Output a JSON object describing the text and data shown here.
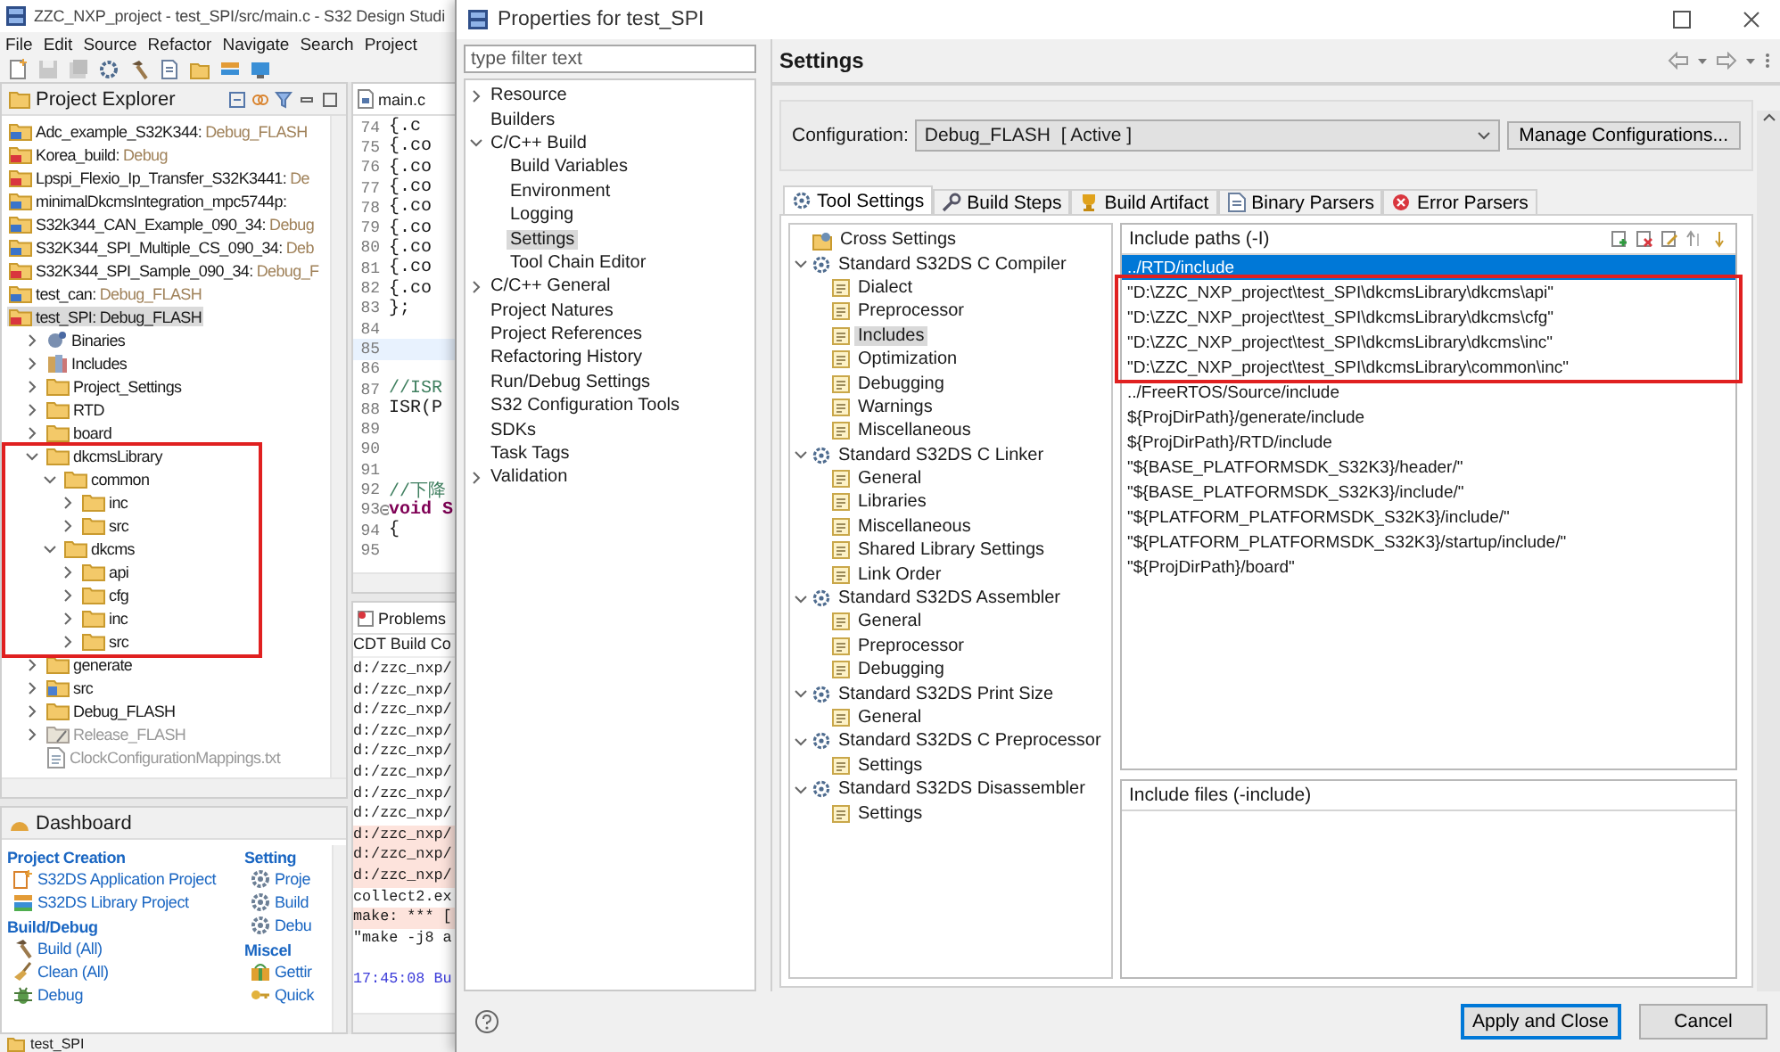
{
  "ide": {
    "title": "ZZC_NXP_project - test_SPI/src/main.c - S32 Design Studi",
    "menu": [
      "File",
      "Edit",
      "Source",
      "Refactor",
      "Navigate",
      "Search",
      "Project"
    ],
    "explorer": {
      "title": "Project Explorer",
      "items": [
        {
          "name": "Adc_example_S32K344:",
          "config": "Debug_FLASH",
          "kind": "project",
          "selected": false
        },
        {
          "name": "Korea_build:",
          "config": "Debug",
          "kind": "closed-project",
          "selected": false
        },
        {
          "name": "Lpspi_Flexio_Ip_Transfer_S32K3441:",
          "config": "De",
          "kind": "closed-project",
          "selected": false
        },
        {
          "name": "minimalDkcmsIntegration_mpc5744p:",
          "kind": "project",
          "selected": false
        },
        {
          "name": "S32k344_CAN_Example_090_34:",
          "config": "Debug",
          "kind": "project",
          "selected": false
        },
        {
          "name": "S32K344_SPI_Multiple_CS_090_34:",
          "config": "Deb",
          "kind": "project",
          "selected": false
        },
        {
          "name": "S32K344_SPI_Sample_090_34:",
          "config": "Debug_F",
          "kind": "closed-project",
          "selected": false
        },
        {
          "name": "test_can:",
          "config": "Debug_FLASH",
          "kind": "project",
          "selected": false
        },
        {
          "name": "test_SPI:",
          "config": "Debug_FLASH",
          "kind": "closed-project",
          "selected": true,
          "children": [
            {
              "name": "Binaries",
              "kind": "binaries",
              "expanded": false,
              "selected": false
            },
            {
              "name": "Includes",
              "kind": "includes",
              "expanded": false,
              "selected": false
            },
            {
              "name": "Project_Settings",
              "kind": "folder",
              "expanded": false,
              "selected": false
            },
            {
              "name": "RTD",
              "kind": "folder",
              "expanded": false,
              "selected": false
            },
            {
              "name": "board",
              "kind": "folder",
              "expanded": false,
              "selected": false
            },
            {
              "name": "dkcmsLibrary",
              "kind": "folder",
              "expanded": true,
              "selected": false,
              "children": [
                {
                  "name": "common",
                  "kind": "folder",
                  "expanded": true,
                  "selected": false,
                  "children": [
                    {
                      "name": "inc",
                      "kind": "folder",
                      "expanded": false,
                      "selected": false
                    },
                    {
                      "name": "src",
                      "kind": "folder",
                      "expanded": false,
                      "selected": false
                    }
                  ]
                },
                {
                  "name": "dkcms",
                  "kind": "folder",
                  "expanded": true,
                  "selected": false,
                  "children": [
                    {
                      "name": "api",
                      "kind": "folder",
                      "expanded": false,
                      "selected": false
                    },
                    {
                      "name": "cfg",
                      "kind": "folder",
                      "expanded": false,
                      "selected": false
                    },
                    {
                      "name": "inc",
                      "kind": "folder",
                      "expanded": false,
                      "selected": false
                    },
                    {
                      "name": "src",
                      "kind": "folder",
                      "expanded": false,
                      "selected": false
                    }
                  ]
                }
              ]
            },
            {
              "name": "generate",
              "kind": "folder",
              "expanded": false,
              "selected": false
            },
            {
              "name": "src",
              "kind": "source-folder",
              "expanded": false,
              "selected": false
            },
            {
              "name": "Debug_FLASH",
              "kind": "folder",
              "expanded": false,
              "selected": false
            },
            {
              "name": "Release_FLASH",
              "kind": "inactive-folder",
              "expanded": false,
              "selected": false
            },
            {
              "name": "ClockConfigurationMappings.txt",
              "kind": "file",
              "selected": false
            }
          ]
        }
      ]
    },
    "editor": {
      "tab": "main.c",
      "lines": [
        {
          "number": "74",
          "code": "{.c"
        },
        {
          "number": "75",
          "code": "{.co"
        },
        {
          "number": "76",
          "code": "{.co"
        },
        {
          "number": "77",
          "code": "{.co"
        },
        {
          "number": "78",
          "code": "{.co"
        },
        {
          "number": "79",
          "code": "{.co"
        },
        {
          "number": "80",
          "code": "{.co"
        },
        {
          "number": "81",
          "code": "{.co"
        },
        {
          "number": "82",
          "code": "{.co"
        },
        {
          "number": "83",
          "code": "};"
        },
        {
          "number": "84"
        },
        {
          "number": "85",
          "current": true
        },
        {
          "number": "86"
        },
        {
          "number": "87",
          "code": "//ISR",
          "kind": "comment"
        },
        {
          "number": "88",
          "code": "ISR(P"
        },
        {
          "number": "89"
        },
        {
          "number": "90"
        },
        {
          "number": "91"
        },
        {
          "number": "92",
          "code": "//下降",
          "kind": "comment"
        },
        {
          "number": "93",
          "code": "void S",
          "kind": "keyword",
          "fold": true
        },
        {
          "number": "94",
          "code": "{"
        },
        {
          "number": "95"
        }
      ]
    },
    "console": {
      "tab": "Problems",
      "header": "CDT Build Co",
      "lines": [
        {
          "text": "d:/zzc_nxp/",
          "kind": "normal"
        },
        {
          "text": "d:/zzc_nxp/",
          "kind": "normal"
        },
        {
          "text": "d:/zzc_nxp/",
          "kind": "normal"
        },
        {
          "text": "d:/zzc_nxp/",
          "kind": "normal"
        },
        {
          "text": "d:/zzc_nxp/",
          "kind": "normal"
        },
        {
          "text": "d:/zzc_nxp/",
          "kind": "normal"
        },
        {
          "text": "d:/zzc_nxp/",
          "kind": "normal"
        },
        {
          "text": "d:/zzc_nxp/",
          "kind": "normal"
        },
        {
          "text": "d:/zzc_nxp/",
          "kind": "error"
        },
        {
          "text": "d:/zzc_nxp/",
          "kind": "error"
        },
        {
          "text": "d:/zzc_nxp/",
          "kind": "error"
        },
        {
          "text": "collect2.ex",
          "kind": "normal"
        },
        {
          "text": "make: *** [",
          "kind": "error"
        },
        {
          "text": "\"make -j8 a",
          "kind": "normal"
        },
        {
          "kind": "blank"
        },
        {
          "text": "17:45:08 Bu",
          "kind": "info"
        }
      ]
    },
    "dashboard": {
      "title": "Dashboard",
      "left": [
        {
          "title": "Project Creation",
          "items": [
            {
              "label": "S32DS Application Project",
              "kind": "new-project"
            },
            {
              "label": "S32DS Library Project",
              "kind": "library"
            }
          ]
        },
        {
          "title": "Build/Debug",
          "items": [
            {
              "label": "Build  (All)",
              "kind": "hammer"
            },
            {
              "label": "Clean  (All)",
              "kind": "broom"
            },
            {
              "label": "Debug",
              "kind": "bug"
            }
          ]
        }
      ],
      "right": [
        {
          "title": "Setting",
          "items": [
            {
              "label": "Proje",
              "kind": "gear"
            },
            {
              "label": "Build",
              "kind": "gear"
            },
            {
              "label": "Debu",
              "kind": "gear"
            }
          ]
        },
        {
          "title": "Miscel",
          "items": [
            {
              "label": "Gettir",
              "kind": "gift"
            },
            {
              "label": "Quick",
              "kind": "key"
            }
          ]
        }
      ]
    },
    "status": "test_SPI"
  },
  "dialog": {
    "title": "Properties for test_SPI",
    "filter": {
      "placeholder": "type filter text"
    },
    "nav": [
      {
        "label": "Resource",
        "expanded": false,
        "selected": false
      },
      {
        "label": "Builders",
        "selected": false
      },
      {
        "label": "C/C++ Build",
        "expanded": true,
        "selected": false,
        "children": [
          {
            "label": "Build Variables",
            "selected": false
          },
          {
            "label": "Environment",
            "selected": false
          },
          {
            "label": "Logging",
            "selected": false
          },
          {
            "label": "Settings",
            "selected": true
          },
          {
            "label": "Tool Chain Editor",
            "selected": false
          }
        ]
      },
      {
        "label": "C/C++ General",
        "expanded": false,
        "selected": false
      },
      {
        "label": "Project Natures",
        "selected": false
      },
      {
        "label": "Project References",
        "selected": false
      },
      {
        "label": "Refactoring History",
        "selected": false
      },
      {
        "label": "Run/Debug Settings",
        "selected": false
      },
      {
        "label": "S32 Configuration Tools",
        "selected": false
      },
      {
        "label": "SDKs",
        "selected": false
      },
      {
        "label": "Task Tags",
        "selected": false
      },
      {
        "label": "Validation",
        "expanded": false,
        "selected": false
      }
    ],
    "page_title": "Settings",
    "configuration": {
      "label": "Configuration:",
      "value": "Debug_FLASH  [ Active ]",
      "button": "Manage Configurations..."
    },
    "tabs": [
      {
        "label": "Tool Settings",
        "kind": "gear",
        "selected": true
      },
      {
        "label": "Build Steps",
        "kind": "wrench",
        "selected": false
      },
      {
        "label": "Build Artifact",
        "kind": "trophy",
        "selected": false
      },
      {
        "label": "Binary Parsers",
        "kind": "document",
        "selected": false
      },
      {
        "label": "Error Parsers",
        "kind": "error",
        "selected": false
      }
    ],
    "tools": [
      {
        "label": "Cross Settings",
        "kind": "settings",
        "selected": false
      },
      {
        "label": "Standard S32DS C Compiler",
        "kind": "tool",
        "expanded": true,
        "selected": false,
        "children": [
          {
            "label": "Dialect",
            "kind": "option",
            "selected": false
          },
          {
            "label": "Preprocessor",
            "kind": "option",
            "selected": false
          },
          {
            "label": "Includes",
            "kind": "option",
            "selected": true
          },
          {
            "label": "Optimization",
            "kind": "option",
            "selected": false
          },
          {
            "label": "Debugging",
            "kind": "option",
            "selected": false
          },
          {
            "label": "Warnings",
            "kind": "option",
            "selected": false
          },
          {
            "label": "Miscellaneous",
            "kind": "option",
            "selected": false
          }
        ]
      },
      {
        "label": "Standard S32DS C Linker",
        "kind": "tool",
        "expanded": true,
        "selected": false,
        "children": [
          {
            "label": "General",
            "kind": "option",
            "selected": false
          },
          {
            "label": "Libraries",
            "kind": "option",
            "selected": false
          },
          {
            "label": "Miscellaneous",
            "kind": "option",
            "selected": false
          },
          {
            "label": "Shared Library Settings",
            "kind": "option",
            "selected": false
          },
          {
            "label": "Link Order",
            "kind": "option",
            "selected": false
          }
        ]
      },
      {
        "label": "Standard S32DS Assembler",
        "kind": "tool",
        "expanded": true,
        "selected": false,
        "children": [
          {
            "label": "General",
            "kind": "option",
            "selected": false
          },
          {
            "label": "Preprocessor",
            "kind": "option",
            "selected": false
          },
          {
            "label": "Debugging",
            "kind": "option",
            "selected": false
          }
        ]
      },
      {
        "label": "Standard S32DS Print Size",
        "kind": "tool",
        "expanded": true,
        "selected": false,
        "children": [
          {
            "label": "General",
            "kind": "option",
            "selected": false
          }
        ]
      },
      {
        "label": "Standard S32DS C Preprocessor",
        "kind": "tool",
        "expanded": true,
        "selected": false,
        "children": [
          {
            "label": "Settings",
            "kind": "option",
            "selected": false
          }
        ]
      },
      {
        "label": "Standard S32DS Disassembler",
        "kind": "tool",
        "expanded": true,
        "selected": false,
        "children": [
          {
            "label": "Settings",
            "kind": "option",
            "selected": false
          }
        ]
      }
    ],
    "include_paths": {
      "title": "Include paths (-I)",
      "items": [
        {
          "path": "../RTD/include",
          "selected": true
        },
        {
          "path": "\"D:\\ZZC_NXP_project\\test_SPI\\dkcmsLibrary\\dkcms\\api\"",
          "selected": false
        },
        {
          "path": "\"D:\\ZZC_NXP_project\\test_SPI\\dkcmsLibrary\\dkcms\\cfg\"",
          "selected": false
        },
        {
          "path": "\"D:\\ZZC_NXP_project\\test_SPI\\dkcmsLibrary\\dkcms\\inc\"",
          "selected": false
        },
        {
          "path": "\"D:\\ZZC_NXP_project\\test_SPI\\dkcmsLibrary\\common\\inc\"",
          "selected": false
        },
        {
          "path": "../FreeRTOS/Source/include",
          "selected": false
        },
        {
          "path": "${ProjDirPath}/generate/include",
          "selected": false
        },
        {
          "path": "${ProjDirPath}/RTD/include",
          "selected": false
        },
        {
          "path": "\"${BASE_PLATFORMSDK_S32K3}/header/\"",
          "selected": false
        },
        {
          "path": "\"${BASE_PLATFORMSDK_S32K3}/include/\"",
          "selected": false
        },
        {
          "path": "\"${PLATFORM_PLATFORMSDK_S32K3}/include/\"",
          "selected": false
        },
        {
          "path": "\"${PLATFORM_PLATFORMSDK_S32K3}/startup/include/\"",
          "selected": false
        },
        {
          "path": "\"${ProjDirPath}/board\"",
          "selected": false
        }
      ]
    },
    "include_files": {
      "title": "Include files (-include)"
    },
    "buttons": [
      {
        "label": "Apply and Close",
        "kind": "default"
      },
      {
        "label": "Cancel",
        "kind": "normal"
      }
    ]
  }
}
